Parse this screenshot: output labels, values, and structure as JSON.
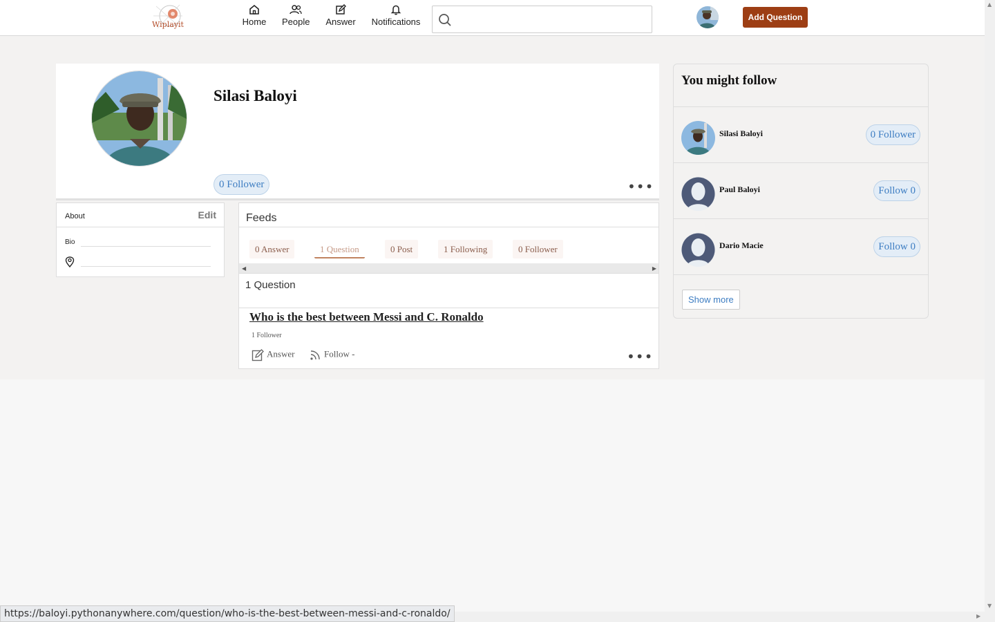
{
  "nav": {
    "logo_text": "Wiplayit",
    "items": [
      {
        "label": "Home",
        "icon": "home-icon"
      },
      {
        "label": "People",
        "icon": "people-icon"
      },
      {
        "label": "Answer",
        "icon": "edit-icon"
      },
      {
        "label": "Notifications",
        "icon": "bell-icon"
      }
    ],
    "search_placeholder": "",
    "add_question_label": "Add Question"
  },
  "profile": {
    "name": "Silasi Baloyi",
    "follower_label": "0 Follower"
  },
  "about": {
    "title": "About",
    "edit_label": "Edit",
    "bio_label": "Bio"
  },
  "feeds": {
    "title": "Feeds",
    "tabs": [
      {
        "label": "0 Answer",
        "active": false
      },
      {
        "label": "1 Question",
        "active": true
      },
      {
        "label": "0 Post",
        "active": false
      },
      {
        "label": "1 Following",
        "active": false
      },
      {
        "label": "0 Follower",
        "active": false
      }
    ],
    "section_title": "1 Question",
    "question": {
      "title": "Who is the best between Messi and C. Ronaldo",
      "followers": "1 Follower",
      "answer_label": "Answer",
      "follow_label": "Follow -"
    }
  },
  "suggestions": {
    "title": "You might follow",
    "people": [
      {
        "name": "Silasi Baloyi",
        "button": "0 Follower",
        "avatar": "photo"
      },
      {
        "name": "Paul Baloyi",
        "button": "Follow 0",
        "avatar": "default-avatar"
      },
      {
        "name": "Dario Macie",
        "button": "Follow 0",
        "avatar": "default-avatar"
      }
    ],
    "show_more_label": "Show more"
  },
  "status_bar": {
    "url": "https://baloyi.pythonanywhere.com/question/who-is-the-best-between-messi-and-c-ronaldo/"
  },
  "colors": {
    "accent": "#9d3e14",
    "link_blue": "#3d7dc2",
    "pill_bg": "#e3edf7"
  }
}
